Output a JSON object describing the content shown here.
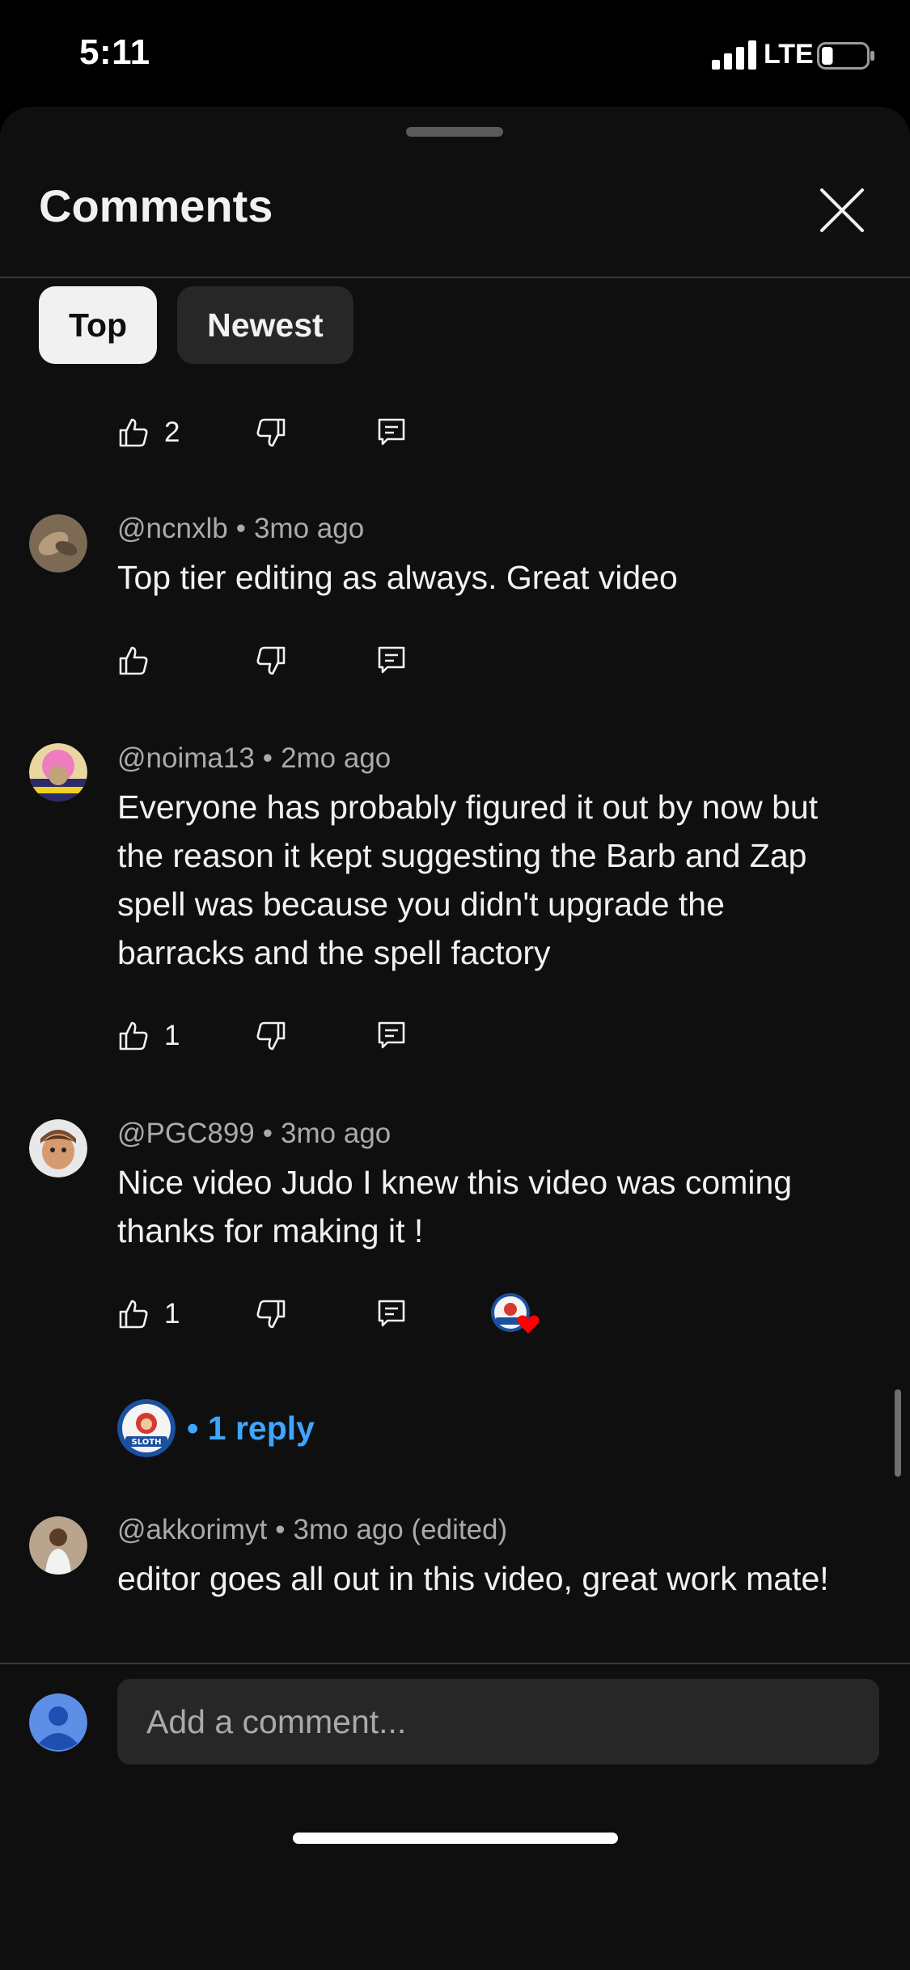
{
  "status_bar": {
    "time": "5:11",
    "network": "LTE",
    "battery_level": 0.25
  },
  "sheet": {
    "title": "Comments",
    "tabs": [
      {
        "label": "Top",
        "active": true
      },
      {
        "label": "Newest",
        "active": false
      }
    ]
  },
  "partial_comment": {
    "likes": "2"
  },
  "comments": [
    {
      "author": "@ncnxlb",
      "age": "3mo ago",
      "text": "Top tier editing as always. Great video",
      "likes": ""
    },
    {
      "author": "@noima13",
      "age": "2mo ago",
      "text": "Everyone has probably figured it out by now but the reason it kept suggesting the Barb and Zap spell was because you didn't upgrade the barracks and the spell factory",
      "likes": "1"
    },
    {
      "author": "@PGC899",
      "age": "3mo ago",
      "text": "Nice video Judo I knew this video was coming thanks for making it !",
      "likes": "1",
      "replies_label": "• 1 reply"
    },
    {
      "author": "@akkorimyt",
      "age": "3mo ago (edited)",
      "text": "editor goes all out in this video, great work mate!",
      "likes": ""
    }
  ],
  "composer": {
    "placeholder": "Add a comment..."
  },
  "colors": {
    "background": "#0f0f0f",
    "chip_active": "#f1f1f1",
    "chip_inactive": "#272727",
    "link": "#3ea6ff",
    "heart": "#ff0000",
    "secondary_text": "#aaaaaa"
  },
  "icons": [
    "signal-icon",
    "battery-icon",
    "close-icon",
    "thumbs-up-icon",
    "thumbs-down-icon",
    "reply-icon",
    "heart-icon",
    "account-icon"
  ]
}
